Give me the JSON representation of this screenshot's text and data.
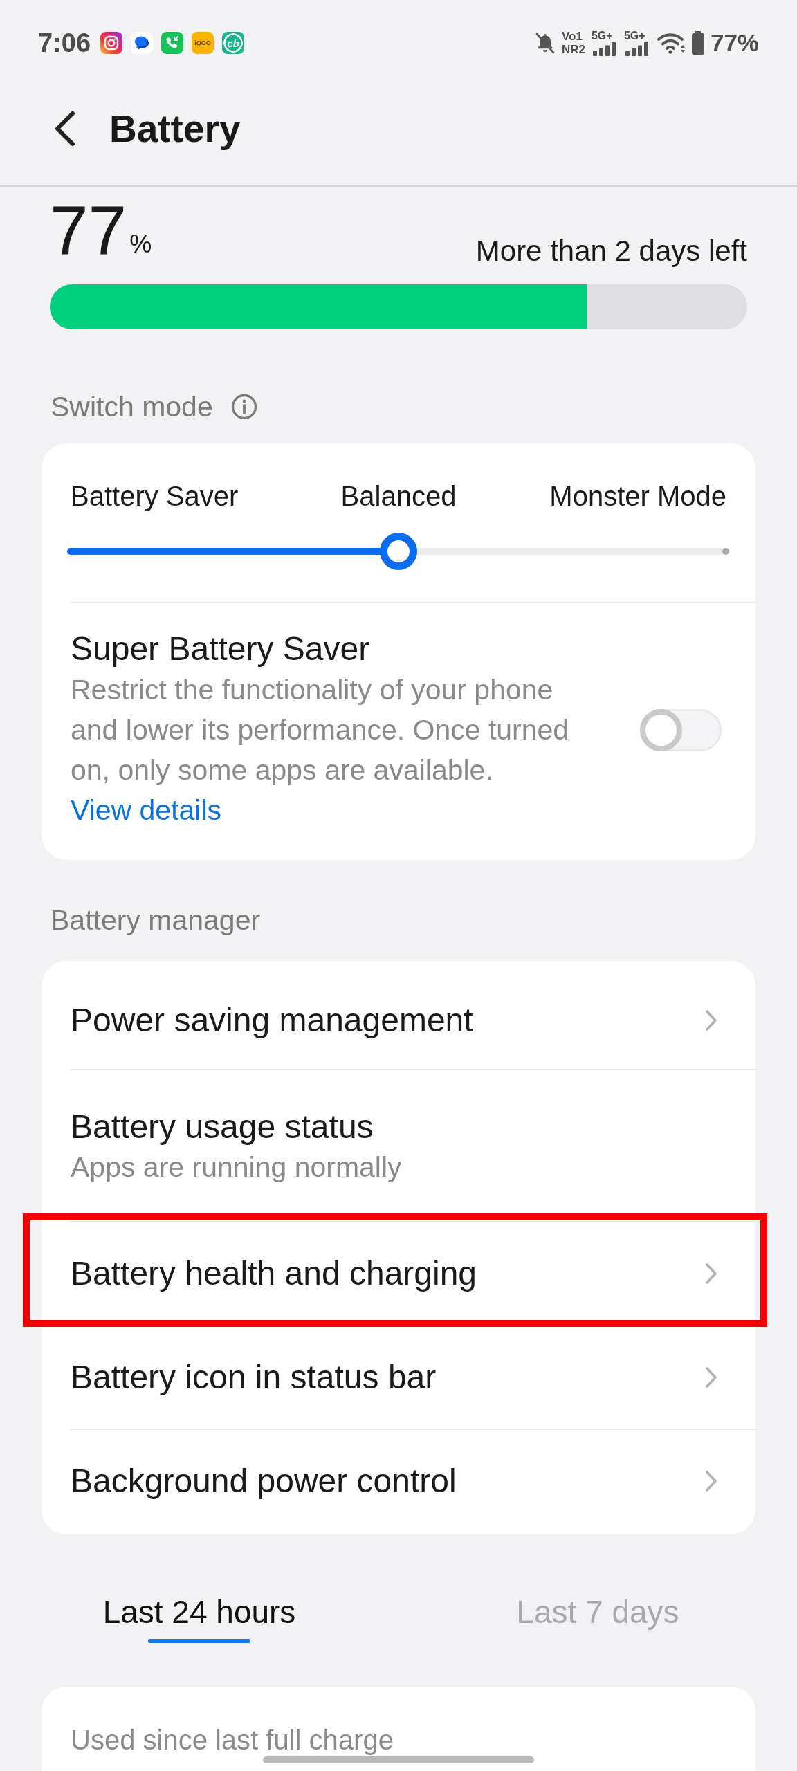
{
  "status_bar": {
    "time": "7:06",
    "notification_icons": [
      {
        "kind": "camera"
      },
      {
        "kind": "chat"
      },
      {
        "kind": "phone"
      },
      {
        "kind": "logo",
        "text": "iQOO",
        "color": "#f7b500"
      },
      {
        "kind": "logo",
        "text": "cb",
        "color": "#14b88a"
      }
    ],
    "silent_mode": true,
    "network_labels": [
      "Vo1",
      "NR2"
    ],
    "signals": [
      {
        "label": "5G+"
      },
      {
        "label": "5G+"
      }
    ],
    "battery_percent": "77%"
  },
  "header": {
    "title": "Battery"
  },
  "battery": {
    "percent": "77",
    "unit": "%",
    "estimate": "More than 2 days left",
    "level": 0.77
  },
  "switch_mode": {
    "title": "Switch mode",
    "modes": [
      "Battery Saver",
      "Balanced",
      "Monster Mode"
    ],
    "slider": {
      "level": 0.5
    }
  },
  "super_battery_saver": {
    "title": "Super Battery Saver",
    "description": "Restrict the functionality of your phone and lower its performance. Once turned on, only some apps are available.",
    "link": "View details",
    "on": false
  },
  "battery_manager": {
    "title": "Battery manager",
    "items": [
      {
        "kind": "nav",
        "title": "Power saving management",
        "highlighted": false
      },
      {
        "kind": "info",
        "title": "Battery usage status",
        "subtitle": "Apps are running normally",
        "highlighted": false
      },
      {
        "kind": "nav",
        "title": "Battery health and charging",
        "highlighted": true
      },
      {
        "kind": "nav",
        "title": "Battery icon in status bar",
        "highlighted": false
      },
      {
        "kind": "nav",
        "title": "Background power control",
        "highlighted": false
      }
    ]
  },
  "tabs": [
    {
      "label": "Last 24 hours",
      "selected": true
    },
    {
      "label": "Last 7 days",
      "selected": false
    }
  ],
  "usage": {
    "title": "Used since last full charge"
  }
}
